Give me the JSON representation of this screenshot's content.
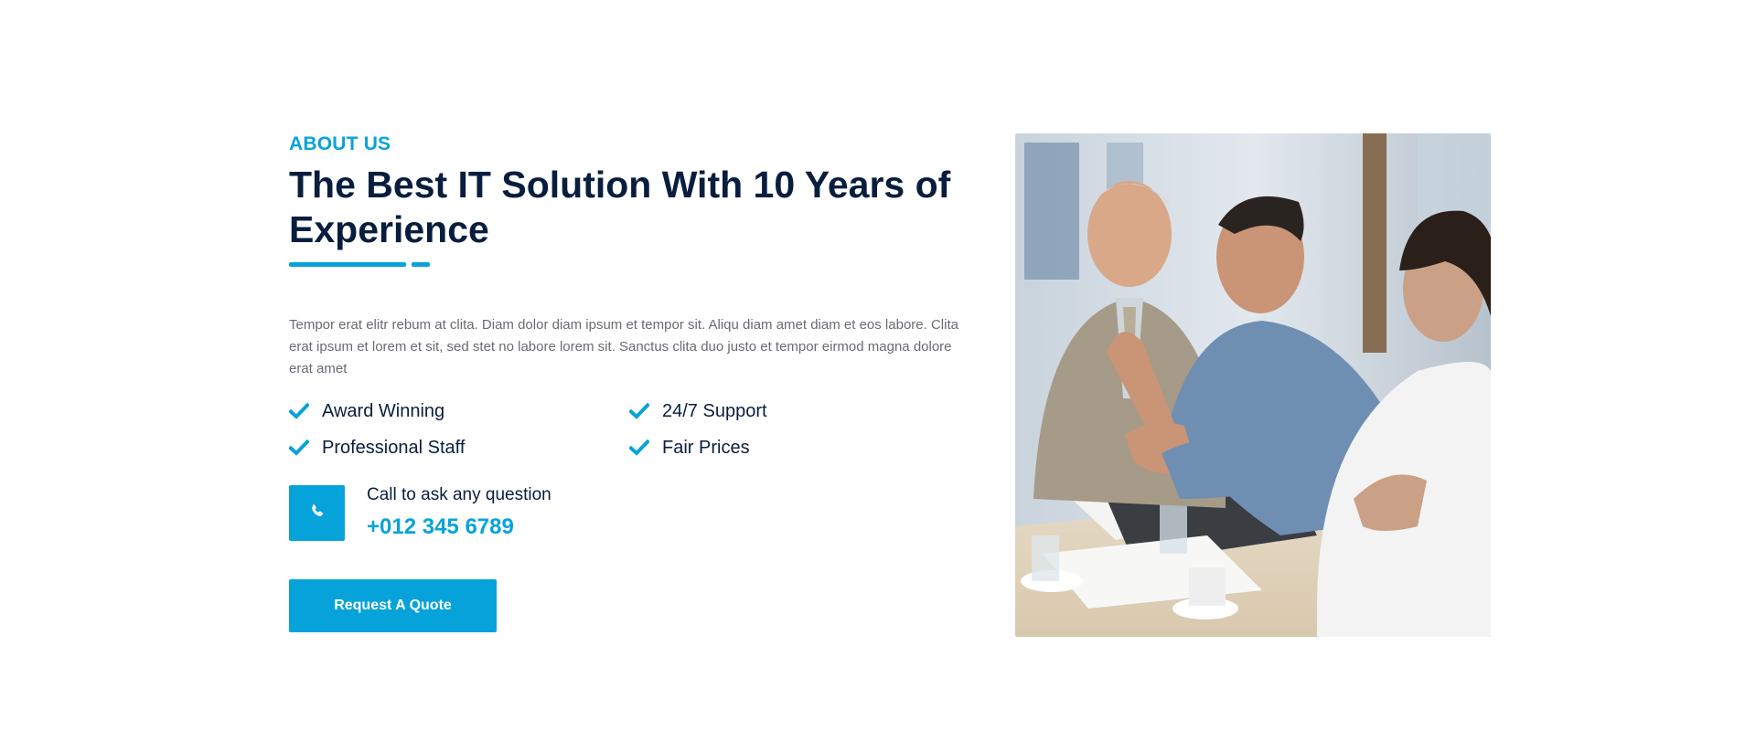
{
  "about": {
    "eyebrow": "ABOUT US",
    "title": "The Best IT Solution With 10 Years of Experience",
    "paragraph": "Tempor erat elitr rebum at clita. Diam dolor diam ipsum et tempor sit. Aliqu diam amet diam et eos labore. Clita erat ipsum et lorem et sit, sed stet no labore lorem sit. Sanctus clita duo justo et tempor eirmod magna dolore erat amet",
    "features": [
      {
        "label": "Award Winning",
        "icon": "check-icon"
      },
      {
        "label": "24/7 Support",
        "icon": "check-icon"
      },
      {
        "label": "Professional Staff",
        "icon": "check-icon"
      },
      {
        "label": "Fair Prices",
        "icon": "check-icon"
      }
    ],
    "call": {
      "label": "Call to ask any question",
      "number": "+012 345 6789",
      "icon": "phone-icon"
    },
    "button_label": "Request A Quote"
  },
  "image": {
    "subject": "business-meeting-photo"
  },
  "colors": {
    "accent": "#06A3DA",
    "heading": "#091E3E",
    "body_text": "#6B6A75"
  }
}
